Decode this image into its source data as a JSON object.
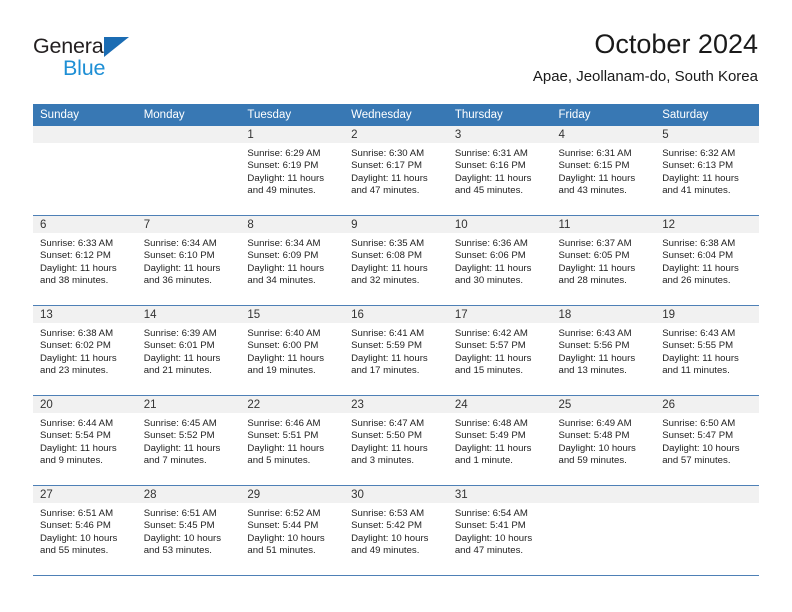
{
  "logo": {
    "primary_text": "General",
    "secondary_text": "Blue",
    "primary_color": "#231f20",
    "secondary_color": "#1e8fd5",
    "triangle_color": "#1b6cb3"
  },
  "header": {
    "title": "October 2024",
    "subtitle": "Apae, Jeollanam-do, South Korea"
  },
  "theme": {
    "header_row_bg": "#3878b4",
    "header_row_text": "#ffffff",
    "daynum_bg": "#f1f1f1",
    "row_divider": "#4e80b6"
  },
  "weekdays": [
    "Sunday",
    "Monday",
    "Tuesday",
    "Wednesday",
    "Thursday",
    "Friday",
    "Saturday"
  ],
  "weeks": [
    [
      {
        "day": "",
        "sunrise": "",
        "sunset": "",
        "daylight_line1": "",
        "daylight_line2": ""
      },
      {
        "day": "",
        "sunrise": "",
        "sunset": "",
        "daylight_line1": "",
        "daylight_line2": ""
      },
      {
        "day": "1",
        "sunrise": "Sunrise: 6:29 AM",
        "sunset": "Sunset: 6:19 PM",
        "daylight_line1": "Daylight: 11 hours",
        "daylight_line2": "and 49 minutes."
      },
      {
        "day": "2",
        "sunrise": "Sunrise: 6:30 AM",
        "sunset": "Sunset: 6:17 PM",
        "daylight_line1": "Daylight: 11 hours",
        "daylight_line2": "and 47 minutes."
      },
      {
        "day": "3",
        "sunrise": "Sunrise: 6:31 AM",
        "sunset": "Sunset: 6:16 PM",
        "daylight_line1": "Daylight: 11 hours",
        "daylight_line2": "and 45 minutes."
      },
      {
        "day": "4",
        "sunrise": "Sunrise: 6:31 AM",
        "sunset": "Sunset: 6:15 PM",
        "daylight_line1": "Daylight: 11 hours",
        "daylight_line2": "and 43 minutes."
      },
      {
        "day": "5",
        "sunrise": "Sunrise: 6:32 AM",
        "sunset": "Sunset: 6:13 PM",
        "daylight_line1": "Daylight: 11 hours",
        "daylight_line2": "and 41 minutes."
      }
    ],
    [
      {
        "day": "6",
        "sunrise": "Sunrise: 6:33 AM",
        "sunset": "Sunset: 6:12 PM",
        "daylight_line1": "Daylight: 11 hours",
        "daylight_line2": "and 38 minutes."
      },
      {
        "day": "7",
        "sunrise": "Sunrise: 6:34 AM",
        "sunset": "Sunset: 6:10 PM",
        "daylight_line1": "Daylight: 11 hours",
        "daylight_line2": "and 36 minutes."
      },
      {
        "day": "8",
        "sunrise": "Sunrise: 6:34 AM",
        "sunset": "Sunset: 6:09 PM",
        "daylight_line1": "Daylight: 11 hours",
        "daylight_line2": "and 34 minutes."
      },
      {
        "day": "9",
        "sunrise": "Sunrise: 6:35 AM",
        "sunset": "Sunset: 6:08 PM",
        "daylight_line1": "Daylight: 11 hours",
        "daylight_line2": "and 32 minutes."
      },
      {
        "day": "10",
        "sunrise": "Sunrise: 6:36 AM",
        "sunset": "Sunset: 6:06 PM",
        "daylight_line1": "Daylight: 11 hours",
        "daylight_line2": "and 30 minutes."
      },
      {
        "day": "11",
        "sunrise": "Sunrise: 6:37 AM",
        "sunset": "Sunset: 6:05 PM",
        "daylight_line1": "Daylight: 11 hours",
        "daylight_line2": "and 28 minutes."
      },
      {
        "day": "12",
        "sunrise": "Sunrise: 6:38 AM",
        "sunset": "Sunset: 6:04 PM",
        "daylight_line1": "Daylight: 11 hours",
        "daylight_line2": "and 26 minutes."
      }
    ],
    [
      {
        "day": "13",
        "sunrise": "Sunrise: 6:38 AM",
        "sunset": "Sunset: 6:02 PM",
        "daylight_line1": "Daylight: 11 hours",
        "daylight_line2": "and 23 minutes."
      },
      {
        "day": "14",
        "sunrise": "Sunrise: 6:39 AM",
        "sunset": "Sunset: 6:01 PM",
        "daylight_line1": "Daylight: 11 hours",
        "daylight_line2": "and 21 minutes."
      },
      {
        "day": "15",
        "sunrise": "Sunrise: 6:40 AM",
        "sunset": "Sunset: 6:00 PM",
        "daylight_line1": "Daylight: 11 hours",
        "daylight_line2": "and 19 minutes."
      },
      {
        "day": "16",
        "sunrise": "Sunrise: 6:41 AM",
        "sunset": "Sunset: 5:59 PM",
        "daylight_line1": "Daylight: 11 hours",
        "daylight_line2": "and 17 minutes."
      },
      {
        "day": "17",
        "sunrise": "Sunrise: 6:42 AM",
        "sunset": "Sunset: 5:57 PM",
        "daylight_line1": "Daylight: 11 hours",
        "daylight_line2": "and 15 minutes."
      },
      {
        "day": "18",
        "sunrise": "Sunrise: 6:43 AM",
        "sunset": "Sunset: 5:56 PM",
        "daylight_line1": "Daylight: 11 hours",
        "daylight_line2": "and 13 minutes."
      },
      {
        "day": "19",
        "sunrise": "Sunrise: 6:43 AM",
        "sunset": "Sunset: 5:55 PM",
        "daylight_line1": "Daylight: 11 hours",
        "daylight_line2": "and 11 minutes."
      }
    ],
    [
      {
        "day": "20",
        "sunrise": "Sunrise: 6:44 AM",
        "sunset": "Sunset: 5:54 PM",
        "daylight_line1": "Daylight: 11 hours",
        "daylight_line2": "and 9 minutes."
      },
      {
        "day": "21",
        "sunrise": "Sunrise: 6:45 AM",
        "sunset": "Sunset: 5:52 PM",
        "daylight_line1": "Daylight: 11 hours",
        "daylight_line2": "and 7 minutes."
      },
      {
        "day": "22",
        "sunrise": "Sunrise: 6:46 AM",
        "sunset": "Sunset: 5:51 PM",
        "daylight_line1": "Daylight: 11 hours",
        "daylight_line2": "and 5 minutes."
      },
      {
        "day": "23",
        "sunrise": "Sunrise: 6:47 AM",
        "sunset": "Sunset: 5:50 PM",
        "daylight_line1": "Daylight: 11 hours",
        "daylight_line2": "and 3 minutes."
      },
      {
        "day": "24",
        "sunrise": "Sunrise: 6:48 AM",
        "sunset": "Sunset: 5:49 PM",
        "daylight_line1": "Daylight: 11 hours",
        "daylight_line2": "and 1 minute."
      },
      {
        "day": "25",
        "sunrise": "Sunrise: 6:49 AM",
        "sunset": "Sunset: 5:48 PM",
        "daylight_line1": "Daylight: 10 hours",
        "daylight_line2": "and 59 minutes."
      },
      {
        "day": "26",
        "sunrise": "Sunrise: 6:50 AM",
        "sunset": "Sunset: 5:47 PM",
        "daylight_line1": "Daylight: 10 hours",
        "daylight_line2": "and 57 minutes."
      }
    ],
    [
      {
        "day": "27",
        "sunrise": "Sunrise: 6:51 AM",
        "sunset": "Sunset: 5:46 PM",
        "daylight_line1": "Daylight: 10 hours",
        "daylight_line2": "and 55 minutes."
      },
      {
        "day": "28",
        "sunrise": "Sunrise: 6:51 AM",
        "sunset": "Sunset: 5:45 PM",
        "daylight_line1": "Daylight: 10 hours",
        "daylight_line2": "and 53 minutes."
      },
      {
        "day": "29",
        "sunrise": "Sunrise: 6:52 AM",
        "sunset": "Sunset: 5:44 PM",
        "daylight_line1": "Daylight: 10 hours",
        "daylight_line2": "and 51 minutes."
      },
      {
        "day": "30",
        "sunrise": "Sunrise: 6:53 AM",
        "sunset": "Sunset: 5:42 PM",
        "daylight_line1": "Daylight: 10 hours",
        "daylight_line2": "and 49 minutes."
      },
      {
        "day": "31",
        "sunrise": "Sunrise: 6:54 AM",
        "sunset": "Sunset: 5:41 PM",
        "daylight_line1": "Daylight: 10 hours",
        "daylight_line2": "and 47 minutes."
      },
      {
        "day": "",
        "sunrise": "",
        "sunset": "",
        "daylight_line1": "",
        "daylight_line2": ""
      },
      {
        "day": "",
        "sunrise": "",
        "sunset": "",
        "daylight_line1": "",
        "daylight_line2": ""
      }
    ]
  ]
}
